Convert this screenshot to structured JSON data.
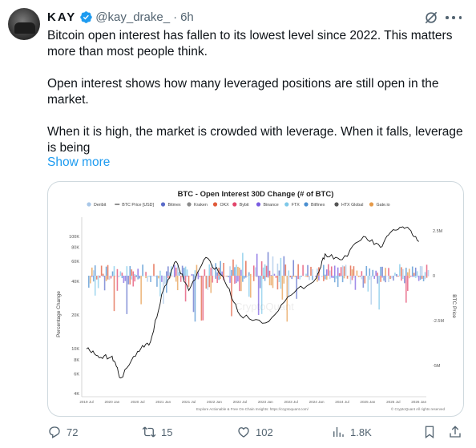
{
  "author": {
    "name": "KAY",
    "handle": "@kay_drake_",
    "separator": "·",
    "time": "6h"
  },
  "icons": {
    "verified": "verified-badge-icon",
    "grok": "grok-icon",
    "more": "more-icon",
    "reply": "reply-icon",
    "retweet": "retweet-icon",
    "like": "heart-icon",
    "views": "views-icon",
    "bookmark": "bookmark-icon",
    "share": "share-icon"
  },
  "colors": {
    "accent": "#1d9bf0",
    "muted": "#536471",
    "verified": "#1d9bf0"
  },
  "tweet": {
    "paragraphs": [
      "Bitcoin open interest has fallen to its lowest level since 2022. This matters more than most people think.",
      "Open interest shows how many leveraged positions are still open in the market.",
      "When it is high, the market is crowded with leverage. When it falls, leverage is being"
    ],
    "show_more": "Show more"
  },
  "chart_data": {
    "type": "area",
    "title": "BTC - Open Interest 30D Change (# of BTC)",
    "ylabel": "Percentage Change",
    "y2label": "BTC Price",
    "legend": [
      "Deribit",
      "BTC Price [USD]",
      "Bitmex",
      "Kraken",
      "OKX",
      "Bybit",
      "Binance",
      "FTX",
      "Bitfinex",
      "HTX Global",
      "Gate.io"
    ],
    "legend_colors": [
      "#a9c7e8",
      "#222222",
      "#5b6cc9",
      "#8a8a8a",
      "#e05a3a",
      "#e2456b",
      "#7a5ce0",
      "#7ec8e8",
      "#4a8fd0",
      "#555555",
      "#e59a4a"
    ],
    "x_ticks": [
      "2019 Jul",
      "2020 Jan",
      "2020 Jul",
      "2021 Jan",
      "2021 Jul",
      "2022 Jan",
      "2022 Jul",
      "2023 Jan",
      "2023 Jul",
      "2024 Jan",
      "2024 Jul",
      "2025 Jan",
      "2025 Jul",
      "2026 Jan"
    ],
    "y_left_ticks": [
      "100K",
      "80K",
      "60K",
      "40K",
      "20K",
      "10K",
      "8K",
      "6K",
      "4K"
    ],
    "y_right_ticks": [
      "2.5M",
      "0",
      "-2.5M",
      "-5M"
    ],
    "price_series": [
      {
        "x": "2019 Jul",
        "y": 10000
      },
      {
        "x": "2019 Oct",
        "y": 8300
      },
      {
        "x": "2020 Jan",
        "y": 8600
      },
      {
        "x": "2020 Mar",
        "y": 5500
      },
      {
        "x": "2020 Jul",
        "y": 9500
      },
      {
        "x": "2020 Oct",
        "y": 11500
      },
      {
        "x": "2021 Jan",
        "y": 33000
      },
      {
        "x": "2021 Apr",
        "y": 60000
      },
      {
        "x": "2021 Jul",
        "y": 33000
      },
      {
        "x": "2021 Nov",
        "y": 65000
      },
      {
        "x": "2022 Mar",
        "y": 44000
      },
      {
        "x": "2022 Jul",
        "y": 20000
      },
      {
        "x": "2023 Jan",
        "y": 17000
      },
      {
        "x": "2023 Jul",
        "y": 30000
      },
      {
        "x": "2024 Jan",
        "y": 43000
      },
      {
        "x": "2024 Mar",
        "y": 70000
      },
      {
        "x": "2024 Jul",
        "y": 62000
      },
      {
        "x": "2024 Dec",
        "y": 100000
      },
      {
        "x": "2025 Apr",
        "y": 80000
      },
      {
        "x": "2025 Jul",
        "y": 115000
      },
      {
        "x": "2025 Oct",
        "y": 120000
      },
      {
        "x": "2026 Jan",
        "y": 90000
      }
    ],
    "watermark": "CryptoQuant",
    "footer_left": "Explore Actionable & Free On-Chain Insights: https://cryptoquant.com/",
    "footer_right": "© CryptoQuant All rights reserved"
  },
  "actions": {
    "replies": "72",
    "retweets": "15",
    "likes": "102",
    "views": "1.8K"
  }
}
